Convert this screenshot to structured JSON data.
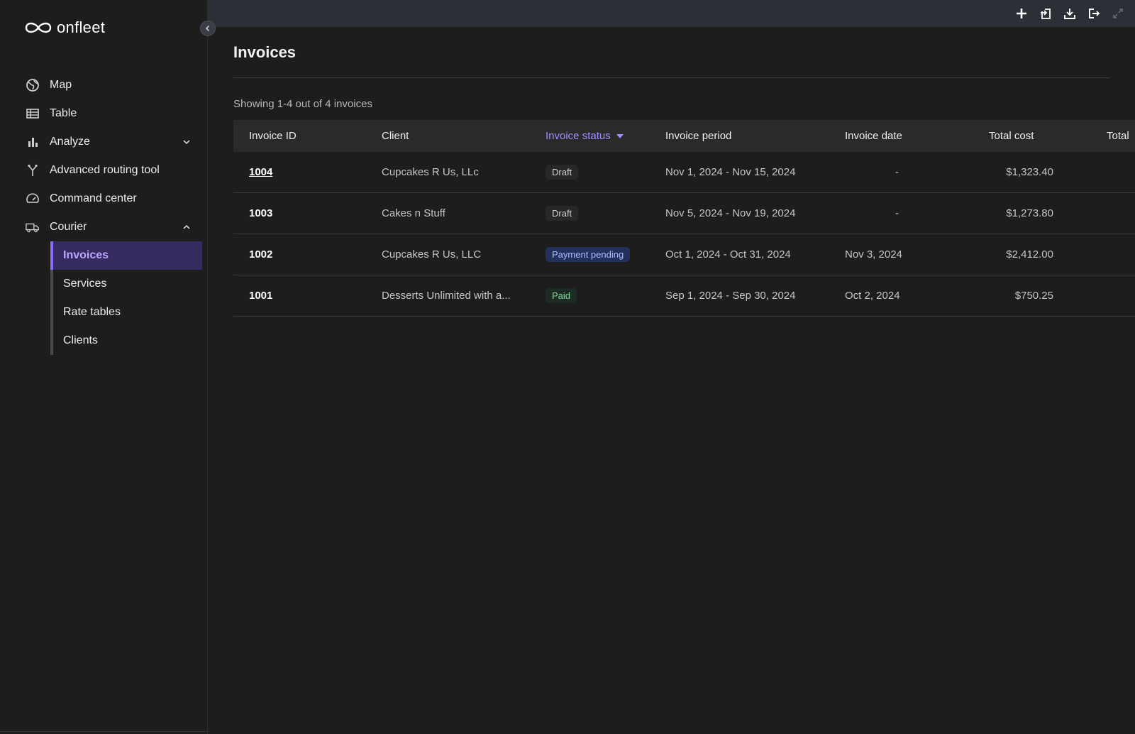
{
  "app": {
    "brand": "onfleet"
  },
  "sidebar": {
    "items": [
      {
        "label": "Map",
        "icon": "globe-icon"
      },
      {
        "label": "Table",
        "icon": "table-icon"
      },
      {
        "label": "Analyze",
        "icon": "bar-chart-icon",
        "expanded": false
      },
      {
        "label": "Advanced routing tool",
        "icon": "routing-icon"
      },
      {
        "label": "Command center",
        "icon": "speedometer-icon"
      },
      {
        "label": "Courier",
        "icon": "truck-icon",
        "expanded": true
      }
    ],
    "courier_sub": [
      {
        "label": "Invoices",
        "active": true
      },
      {
        "label": "Services",
        "active": false
      },
      {
        "label": "Rate tables",
        "active": false
      },
      {
        "label": "Clients",
        "active": false
      }
    ]
  },
  "topbar": {
    "actions": [
      "plus-icon",
      "import-icon",
      "download-icon",
      "logout-icon",
      "expand-icon"
    ]
  },
  "main": {
    "title": "Invoices",
    "showing": "Showing 1-4 out of 4 invoices",
    "columns": {
      "id": "Invoice ID",
      "client": "Client",
      "status": "Invoice status",
      "period": "Invoice period",
      "date": "Invoice date",
      "total": "Total cost",
      "total2": "Total"
    },
    "rows": [
      {
        "id": "1004",
        "client": "Cupcakes R Us, LLc",
        "status": "Draft",
        "status_type": "draft",
        "period": "Nov 1, 2024 - Nov 15, 2024",
        "date": "-",
        "total": "$1,323.40"
      },
      {
        "id": "1003",
        "client": "Cakes n Stuff",
        "status": "Draft",
        "status_type": "draft",
        "period": "Nov 5, 2024 - Nov 19, 2024",
        "date": "-",
        "total": "$1,273.80"
      },
      {
        "id": "1002",
        "client": "Cupcakes R Us, LLC",
        "status": "Payment pending",
        "status_type": "pending",
        "period": "Oct 1, 2024 - Oct 31, 2024",
        "date": "Nov 3, 2024",
        "total": "$2,412.00"
      },
      {
        "id": "1001",
        "client": "Desserts Unlimited with a...",
        "status": "Paid",
        "status_type": "paid",
        "period": "Sep 1, 2024 - Sep 30, 2024",
        "date": "Oct 2, 2024",
        "total": "$750.25"
      }
    ]
  },
  "colors": {
    "accent": "#8b6cff",
    "active_bg": "#352b5f",
    "background": "#1d1d1d"
  }
}
